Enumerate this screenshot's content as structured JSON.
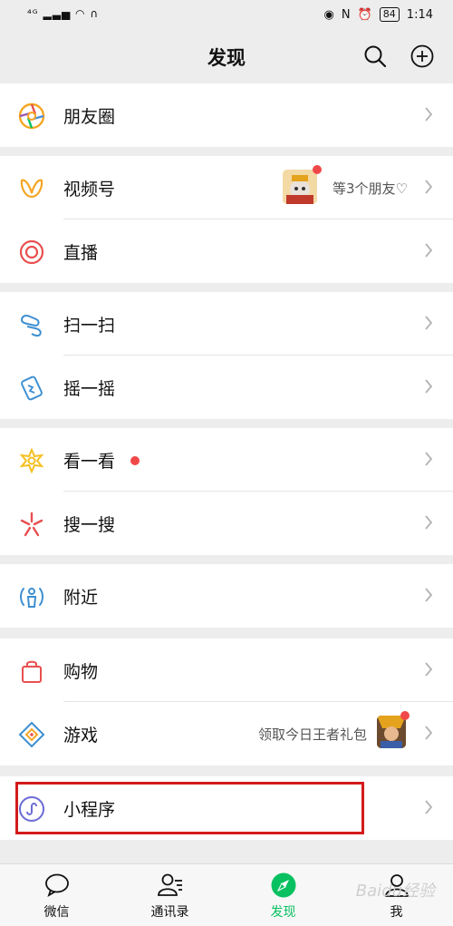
{
  "status_bar": {
    "signal": "⁴ᴳ",
    "battery": "84",
    "time": "1:14"
  },
  "header": {
    "title": "发现"
  },
  "rows": {
    "moments": {
      "label": "朋友圈"
    },
    "channels": {
      "label": "视频号",
      "hint": "等3个朋友♡"
    },
    "live": {
      "label": "直播"
    },
    "scan": {
      "label": "扫一扫"
    },
    "shake": {
      "label": "摇一摇"
    },
    "top_stories": {
      "label": "看一看"
    },
    "search": {
      "label": "搜一搜"
    },
    "nearby": {
      "label": "附近"
    },
    "shopping": {
      "label": "购物"
    },
    "games": {
      "label": "游戏",
      "hint": "领取今日王者礼包"
    },
    "mini_programs": {
      "label": "小程序"
    }
  },
  "tabs": [
    {
      "label": "微信",
      "icon": "chat-icon"
    },
    {
      "label": "通讯录",
      "icon": "contacts-icon"
    },
    {
      "label": "发现",
      "icon": "discover-compass-icon",
      "active": true
    },
    {
      "label": "我",
      "icon": "me-icon"
    }
  ],
  "watermark": "Baidu经验",
  "colors": {
    "accent": "#07c160",
    "highlight_box": "#d31b1b",
    "badge": "#f04848"
  }
}
